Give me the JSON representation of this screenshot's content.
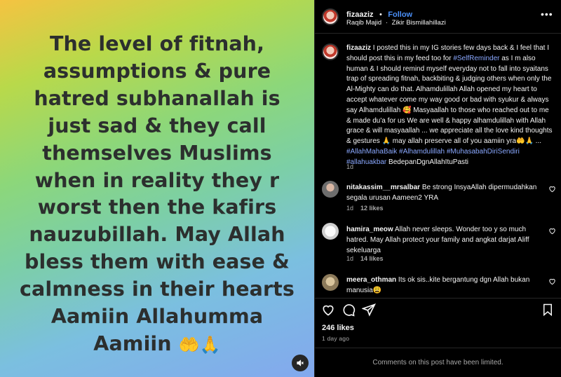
{
  "media": {
    "text": "The level of fitnah, assumptions & pure hatred subhanallah is just sad & they call themselves Muslims when in reality they r worst then the kafirs nauzubillah.  May Allah bless them with ease & calmness in their hearts Aamiin Allahumma Aamiin",
    "emoji": "🤲🙏",
    "mute_icon": "speaker-muted-icon"
  },
  "header": {
    "username": "fizaaziz",
    "separator": "•",
    "follow_label": "Follow",
    "audio_artist": "Raqib Majid",
    "audio_separator": "·",
    "audio_track": "Zikir Bismillahillazi",
    "more_label": "•••"
  },
  "caption": {
    "username": "fizaaziz",
    "text_1": " I posted this in my IG stories few days back & I feel that I should post this in my feed too for ",
    "tag_1": "#SelfReminder",
    "text_2": " as I m also human & I should remind myself everyday not to fall into syaitans trap of spreading fitnah, backbiting & judging others when only the Al-Mighty can do that. Alhamdulillah Allah opened my heart to accept whatever come my way good or bad with syukur & always say Alhamdulillah 🥰 Masyaallah to those who reached out to me & made du'a for us We are well & happy alhamdulillah with Allah grace & will masyaallah ... we appreciate all the love kind thoughts & gestures 🙏 may allah preserve all of you aamiin yra🤲🙏 ... ",
    "tags": "#AllahMahaBaik #Alhamdulillah #MuhasabahDiriSendiri #allahuakbar",
    "text_3": " BedepanDgnAllahItuPasti",
    "time": "1d"
  },
  "comments": [
    {
      "username": "nitakassim__mrsalbar",
      "text": " Be strong InsyaAllah dipermudahkan segala urusan Aameen2 YRA",
      "time": "1d",
      "likes": "12 likes"
    },
    {
      "username": "hamira_meow",
      "text": " Allah never sleeps. Wonder too y so much hatred. May Allah protect your family and angkat darjat Aliff sekeluarga",
      "time": "1d",
      "likes": "14 likes"
    },
    {
      "username": "meera_othman",
      "text": " Its ok sis..kite bergantung dgn Allah bukan manusia😩"
    }
  ],
  "actions": {
    "like_icon": "heart-icon",
    "comment_icon": "comment-icon",
    "share_icon": "paper-plane-icon",
    "save_icon": "bookmark-icon"
  },
  "likes_count": "246 likes",
  "posted_ago": "1 day ago",
  "comments_limited": "Comments on this post have been limited."
}
